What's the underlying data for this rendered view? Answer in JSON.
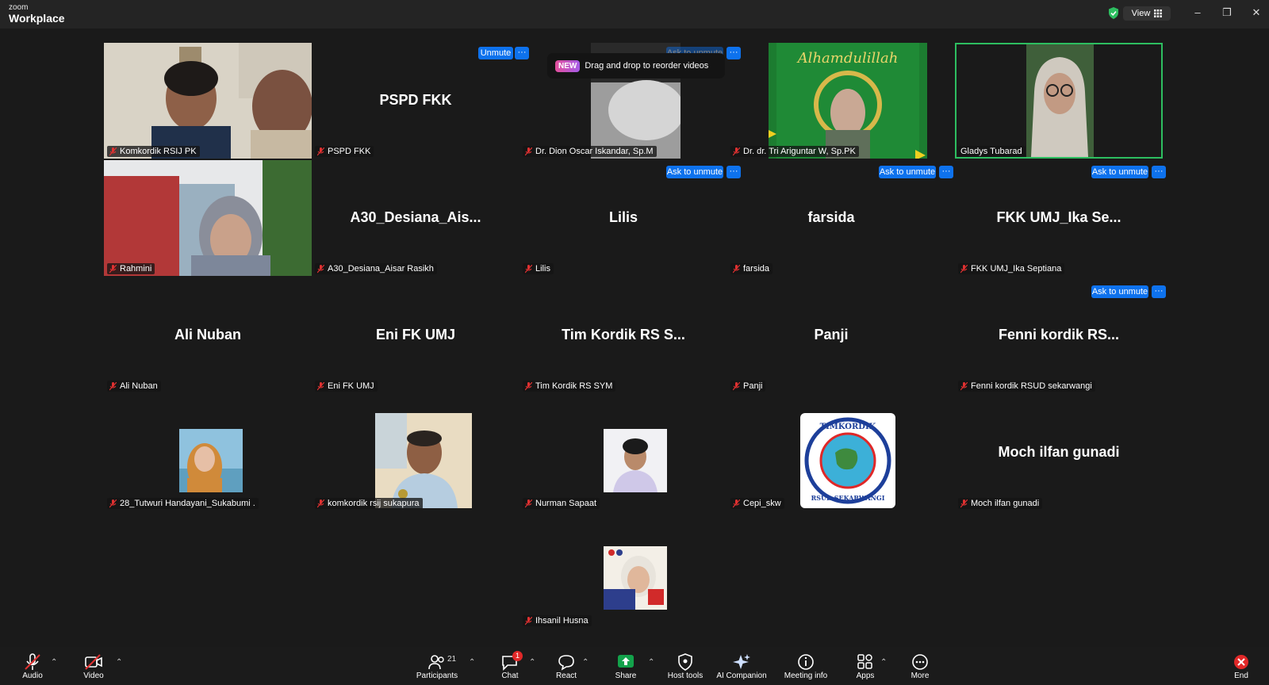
{
  "app": {
    "brand_small": "zoom",
    "brand_large": "Workplace",
    "view_label": "View"
  },
  "tip": {
    "badge": "NEW",
    "text": "Drag and drop to reorder videos"
  },
  "chips": {
    "unmute": "Unmute",
    "ask_to_unmute": "Ask to unmute",
    "more": "···"
  },
  "tiles": [
    {
      "tag": "Komkordik RSIJ PK"
    },
    {
      "tag": "PSPD FKK",
      "big": "PSPD FKK"
    },
    {
      "tag": "Dr. Dion Oscar Iskandar, Sp.M"
    },
    {
      "tag": "Dr. dr. Tri Ariguntar W, Sp.PK",
      "poster_text": "Alhamdulillah"
    },
    {
      "tag": "Gladys Tubarad"
    },
    {
      "tag": "Rahmini"
    },
    {
      "tag": "A30_Desiana_Aisar Rasikh",
      "big": "A30_Desiana_Ais..."
    },
    {
      "tag": "Lilis",
      "big": "Lilis"
    },
    {
      "tag": "farsida",
      "big": "farsida"
    },
    {
      "tag": "FKK UMJ_Ika Septiana",
      "big": "FKK UMJ_Ika Se..."
    },
    {
      "tag": "Ali Nuban",
      "big": "Ali Nuban"
    },
    {
      "tag": "Eni FK UMJ",
      "big": "Eni FK UMJ"
    },
    {
      "tag": "Tim Kordik RS SYM",
      "big": "Tim Kordik RS S..."
    },
    {
      "tag": "Panji",
      "big": "Panji"
    },
    {
      "tag": "Fenni kordik RSUD sekarwangi",
      "big": "Fenni kordik RS..."
    },
    {
      "tag": "28_Tutwuri Handayani_Sukabumi ."
    },
    {
      "tag": "komkordik rsij sukapura"
    },
    {
      "tag": "Nurman Sapaat"
    },
    {
      "tag": "Cepi_skw",
      "logo_top": "TIMKORDIK",
      "logo_bottom": "RSUD SEKARWANGI"
    },
    {
      "tag": "Moch ilfan gunadi",
      "big": "Moch ilfan gunadi"
    },
    {
      "tag": "Ihsanil Husna"
    }
  ],
  "toolbar": {
    "audio": "Audio",
    "video": "Video",
    "participants": "Participants",
    "participants_count": "21",
    "chat": "Chat",
    "chat_badge": "1",
    "react": "React",
    "share": "Share",
    "host_tools": "Host tools",
    "ai_companion": "AI Companion",
    "meeting_info": "Meeting info",
    "apps": "Apps",
    "more": "More",
    "end": "End"
  },
  "colors": {
    "background": "#1a1a1a",
    "chip_blue": "#0e72ed",
    "active_speaker": "#2dbe60",
    "share_green": "#13a24b",
    "end_red": "#e02828"
  }
}
